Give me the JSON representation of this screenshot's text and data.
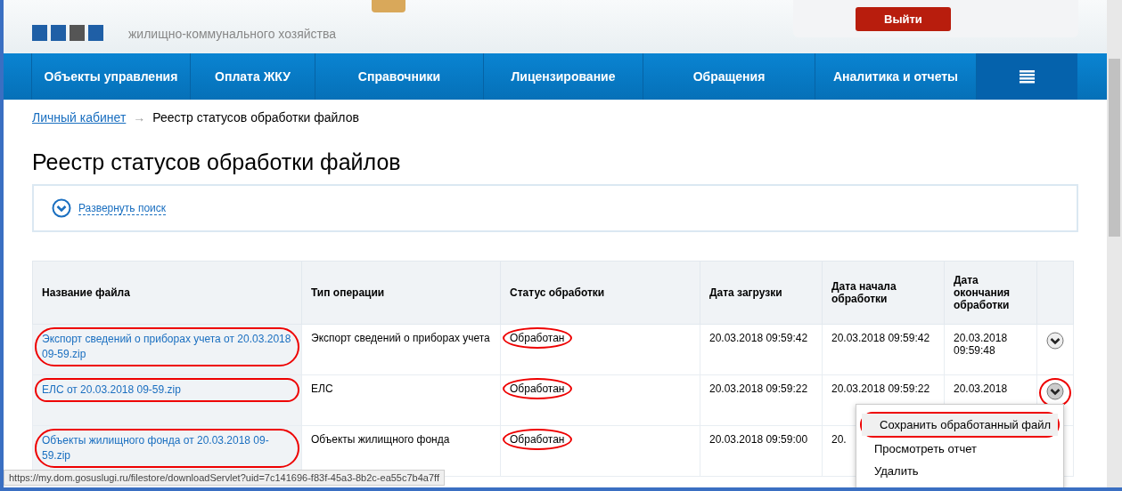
{
  "header": {
    "subtitle": "жилищно-коммунального хозяйства",
    "logout_button": "Выйти"
  },
  "nav": [
    {
      "label": "Объекты управления"
    },
    {
      "label": "Оплата ЖКУ"
    },
    {
      "label": "Справочники"
    },
    {
      "label": "Лицензирование"
    },
    {
      "label": "Обращения"
    },
    {
      "label": "Аналитика и отчеты"
    }
  ],
  "breadcrumb": {
    "link": "Личный кабинет",
    "separator": "→",
    "current": "Реестр статусов обработки файлов"
  },
  "title": "Реестр статусов обработки файлов",
  "search": {
    "toggle": "Развернуть поиск"
  },
  "table": {
    "columns": [
      "Название файла",
      "Тип операции",
      "Статус обработки",
      "Дата загрузки",
      "Дата начала обработки",
      "Дата окончания обработки"
    ],
    "rows": [
      {
        "file": "Экспорт сведений о приборах учета от 20.03.2018 09-59.zip",
        "operation": "Экспорт сведений о приборах учета",
        "status": "Обработан",
        "uploaded": "20.03.2018 09:59:42",
        "started": "20.03.2018 09:59:42",
        "finished": "20.03.2018 09:59:48",
        "circled": true,
        "menu_open": false,
        "action_hidden": false
      },
      {
        "file": "ЕЛС от 20.03.2018 09-59.zip",
        "operation": "ЕЛС",
        "status": "Обработан",
        "uploaded": "20.03.2018 09:59:22",
        "started": "20.03.2018 09:59:22",
        "finished": "20.03.2018",
        "circled": true,
        "menu_open": true,
        "action_hidden": false
      },
      {
        "file": "Объекты жилищного фонда от 20.03.2018 09-59.zip",
        "operation": "Объекты жилищного фонда",
        "status": "Обработан",
        "uploaded": "20.03.2018 09:59:00",
        "started": "20.",
        "finished": "",
        "circled": true,
        "menu_open": false,
        "action_hidden": true
      }
    ]
  },
  "row_menu": [
    {
      "label": "Сохранить обработанный файл",
      "selected": true,
      "circled": true
    },
    {
      "label": "Просмотреть отчет",
      "selected": false,
      "circled": false
    },
    {
      "label": "Удалить",
      "selected": false,
      "circled": false
    }
  ],
  "status_bar": {
    "url": "https://my.dom.gosuslugi.ru/filestore/downloadServlet?uid=7c141696-f83f-45a3-8b2c-ea55c7b4a7ff"
  }
}
